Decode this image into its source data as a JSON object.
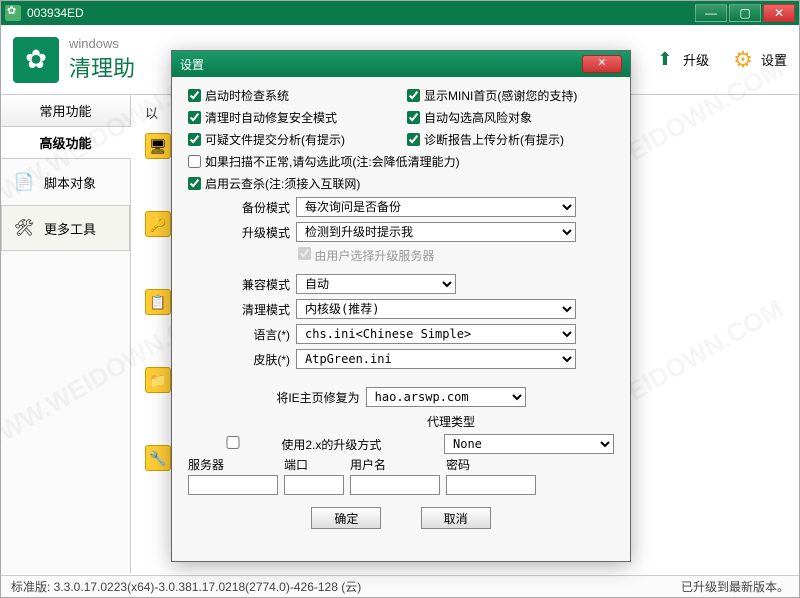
{
  "window": {
    "title": "003934ED"
  },
  "header": {
    "brand_en": "windows",
    "brand_cn": "清理助",
    "upgrade": "升级",
    "settings": "设置"
  },
  "sidebar": {
    "tab_common": "常用功能",
    "tab_advanced": "高级功能",
    "item_script": "脚本对象",
    "item_more": "更多工具"
  },
  "content": {
    "hint_prefix": "以"
  },
  "dialog": {
    "title": "设置",
    "chk_startup": "启动时检查系统",
    "chk_mini": "显示MINI首页(感谢您的支持)",
    "chk_safe": "清理时自动修复安全模式",
    "chk_highrisk": "自动勾选高风险对象",
    "chk_suspect": "可疑文件提交分析(有提示)",
    "chk_diag": "诊断报告上传分析(有提示)",
    "chk_abnormal": "如果扫描不正常,请勾选此项(注:会降低清理能力)",
    "chk_cloud": "启用云查杀(注:须接入互联网)",
    "lbl_backup": "备份模式",
    "val_backup": "每次询问是否备份",
    "lbl_upgrade": "升级模式",
    "val_upgrade": "检测到升级时提示我",
    "note_userserver": "由用户选择升级服务器",
    "lbl_compat": "兼容模式",
    "val_compat": "自动",
    "lbl_clean": "清理模式",
    "val_clean": "内核级(推荐)",
    "lbl_lang": "语言(*)",
    "val_lang": "chs.ini<Chinese Simple>",
    "lbl_skin": "皮肤(*)",
    "val_skin": "AtpGreen.ini",
    "lbl_homepage": "将IE主页修复为",
    "val_homepage": "hao.arswp.com",
    "lbl_proxytype": "代理类型",
    "chk_2x": "使用2.x的升级方式",
    "val_proxytype": "None",
    "lbl_server": "服务器",
    "lbl_port": "端口",
    "lbl_user": "用户名",
    "lbl_pass": "密码",
    "btn_ok": "确定",
    "btn_cancel": "取消"
  },
  "status": {
    "left": "标准版: 3.3.0.17.0223(x64)-3.0.381.17.0218(2774.0)-426-128 (云)",
    "right": "已升级到最新版本。"
  },
  "watermark": "WWW.WEIDOWN.COM"
}
